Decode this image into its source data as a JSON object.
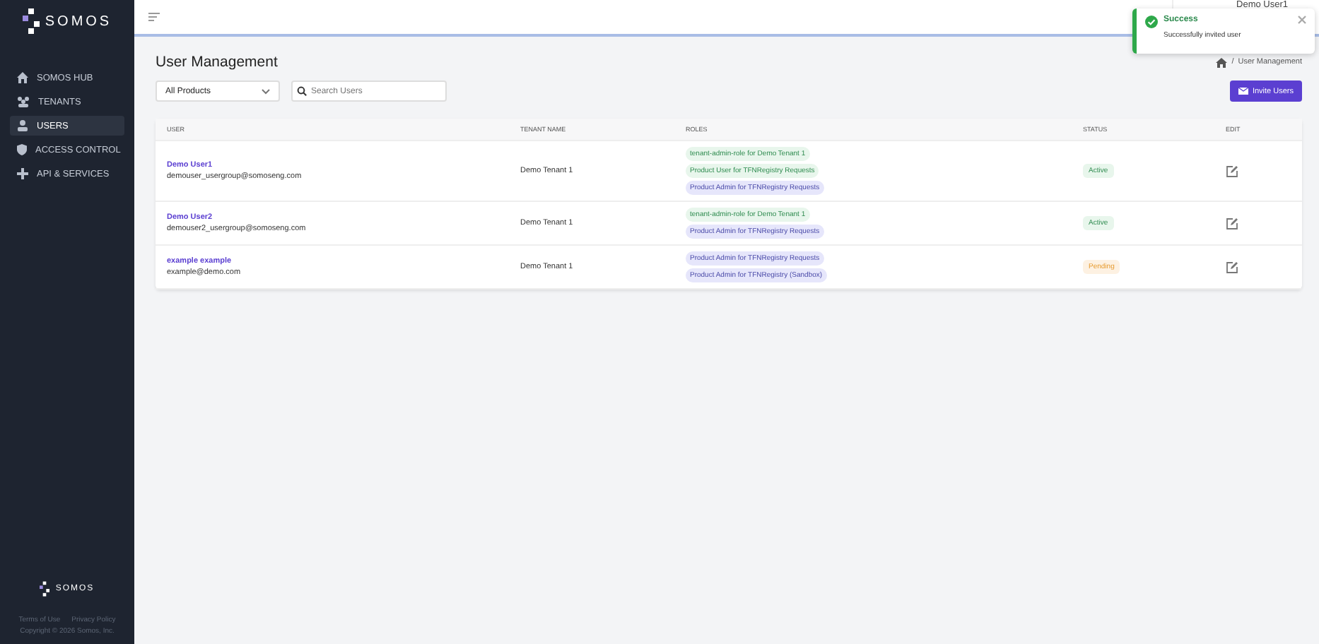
{
  "brand": "SOMOS",
  "sidebar": {
    "items": [
      {
        "label": "SOMOS HUB",
        "selected": false
      },
      {
        "label": "TENANTS",
        "selected": false
      },
      {
        "label": "USERS",
        "selected": true
      },
      {
        "label": "ACCESS CONTROL",
        "selected": false
      },
      {
        "label": "API & SERVICES",
        "selected": false
      }
    ],
    "footer_brand": "SOMOS",
    "links": [
      "Terms of Use",
      "Privacy Policy"
    ],
    "copyright": "Copyright © 2026 Somos, Inc."
  },
  "user_name": "Demo User1",
  "toast": {
    "title": "Success",
    "message": "Successfully invited user"
  },
  "page_title": "User Management",
  "breadcrumb_separator": "/",
  "breadcrumb": "User Management",
  "product_select": "All Products",
  "search": {
    "placeholder": "Search Users"
  },
  "invite_button": "Invite Users",
  "table": {
    "columns": [
      "USER",
      "TENANT NAME",
      "ROLES",
      "STATUS",
      "EDIT"
    ],
    "rows": [
      {
        "name": "Demo User1",
        "email": "demouser_usergroup@somoseng.com",
        "tenant": "Demo Tenant 1",
        "roles": [
          {
            "label": "tenant-admin-role for Demo Tenant 1",
            "kind": "green"
          },
          {
            "label": "Product User for TFNRegistry Requests",
            "kind": "green"
          },
          {
            "label": "Product Admin for TFNRegistry Requests",
            "kind": "purple"
          }
        ],
        "status": {
          "label": "Active",
          "kind": "active"
        }
      },
      {
        "name": "Demo User2",
        "email": "demouser2_usergroup@somoseng.com",
        "tenant": "Demo Tenant 1",
        "roles": [
          {
            "label": "tenant-admin-role for Demo Tenant 1",
            "kind": "green"
          },
          {
            "label": "Product Admin for TFNRegistry Requests",
            "kind": "purple"
          }
        ],
        "status": {
          "label": "Active",
          "kind": "active"
        }
      },
      {
        "name": "example example",
        "email": "example@demo.com",
        "tenant": "Demo Tenant 1",
        "roles": [
          {
            "label": "Product Admin for TFNRegistry Requests",
            "kind": "purple"
          },
          {
            "label": "Product Admin for TFNRegistry (Sandbox)",
            "kind": "purple"
          }
        ],
        "status": {
          "label": "Pending",
          "kind": "pending"
        }
      }
    ]
  }
}
